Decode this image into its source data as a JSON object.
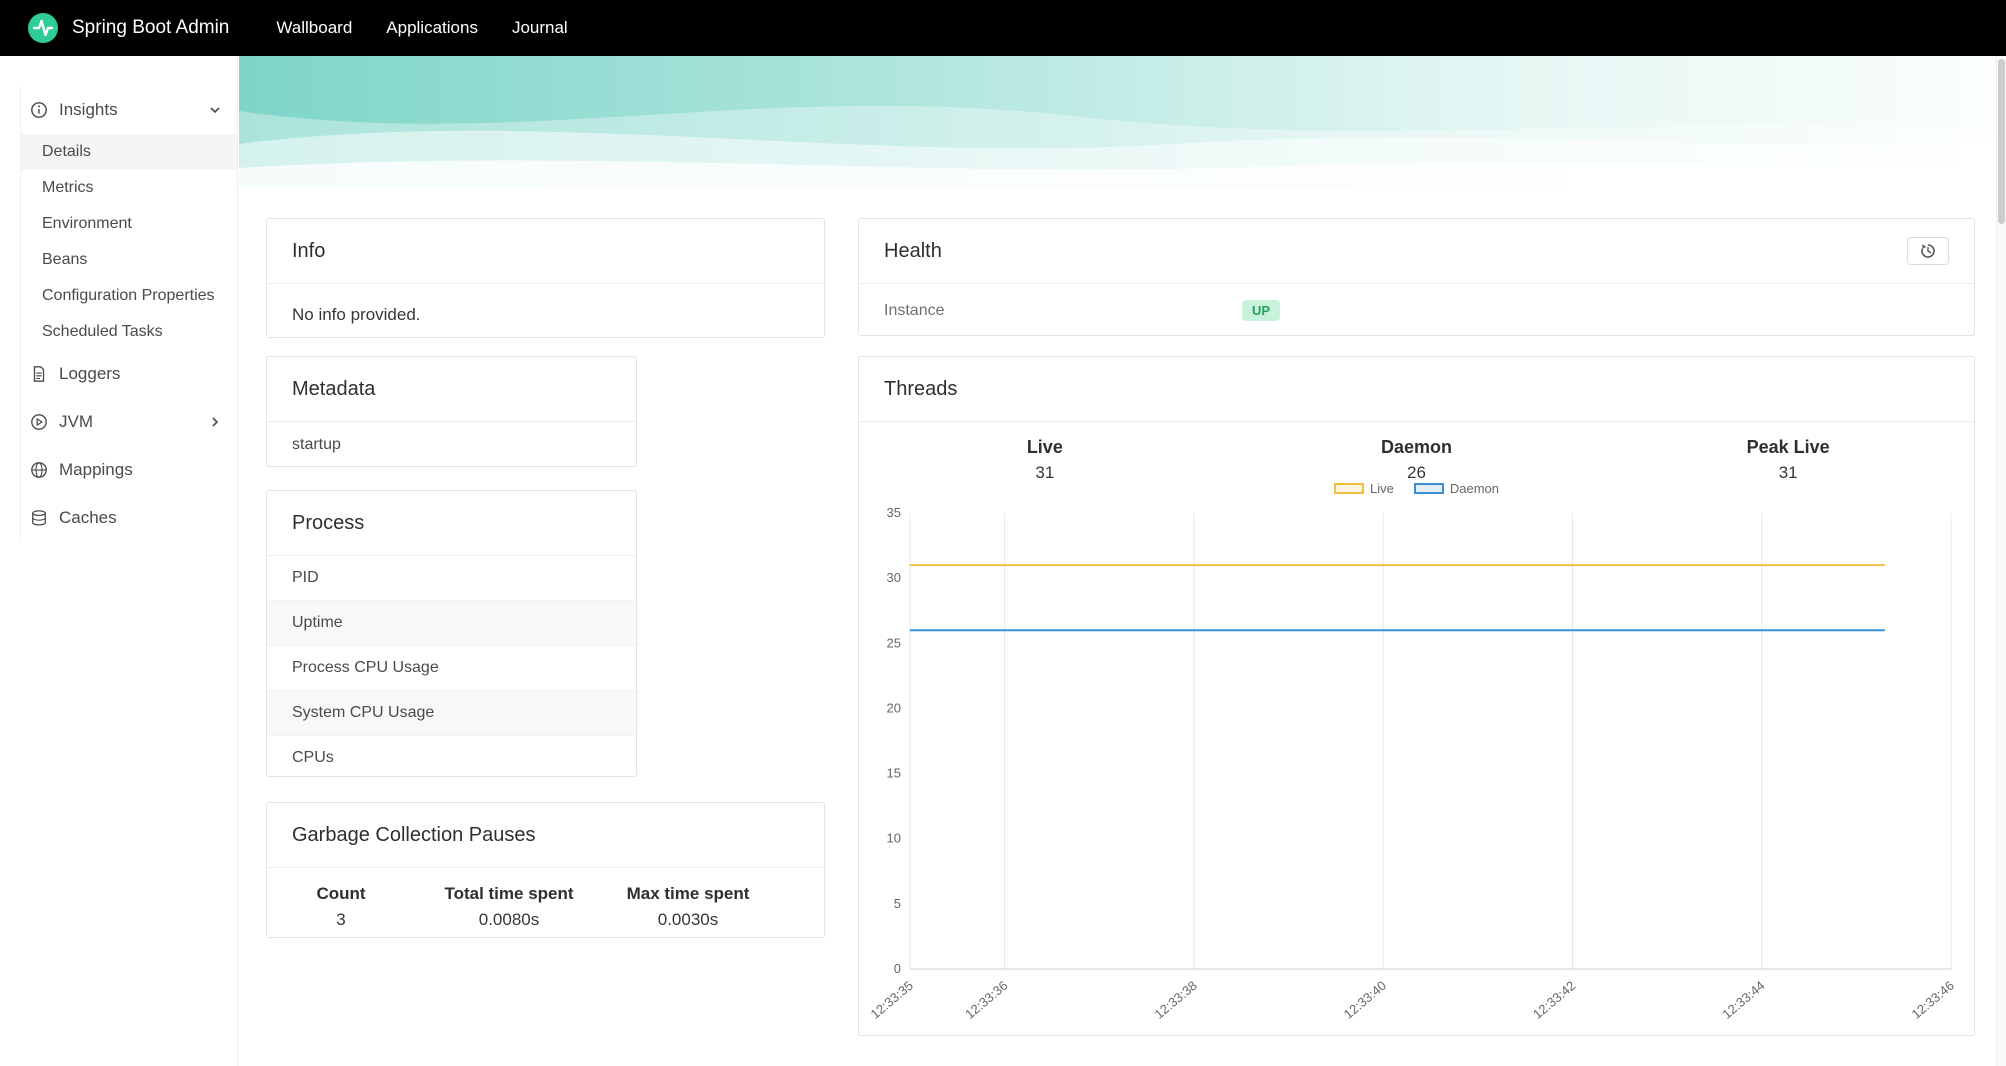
{
  "navbar": {
    "brand": "Spring Boot Admin",
    "items": [
      "Wallboard",
      "Applications",
      "Journal"
    ]
  },
  "sidebar": {
    "insights": {
      "label": "Insights",
      "children": [
        "Details",
        "Metrics",
        "Environment",
        "Beans",
        "Configuration Properties",
        "Scheduled Tasks"
      ],
      "active_child": "Details"
    },
    "items": [
      "Loggers",
      "JVM",
      "Mappings",
      "Caches"
    ]
  },
  "panels": {
    "info": {
      "title": "Info",
      "body": "No info provided."
    },
    "health": {
      "title": "Health",
      "instance_label": "Instance",
      "status": "UP"
    },
    "metadata": {
      "title": "Metadata",
      "rows": [
        "startup"
      ]
    },
    "process": {
      "title": "Process",
      "rows": [
        "PID",
        "Uptime",
        "Process CPU Usage",
        "System CPU Usage",
        "CPUs"
      ]
    },
    "gc": {
      "title": "Garbage Collection Pauses",
      "columns": [
        "Count",
        "Total time spent",
        "Max time spent"
      ],
      "values": [
        "3",
        "0.0080s",
        "0.0030s"
      ]
    },
    "threads": {
      "title": "Threads",
      "stats": [
        {
          "label": "Live",
          "value": "31"
        },
        {
          "label": "Daemon",
          "value": "26"
        },
        {
          "label": "Peak Live",
          "value": "31"
        }
      ]
    }
  },
  "colors": {
    "logo_green": "#2fcc9a",
    "navbar_bg": "#000000",
    "badge_up_bg": "#c8f2dc",
    "badge_up_text": "#27a05d",
    "hero_teal": "#7ed5c8"
  },
  "chart_data": {
    "type": "line",
    "title": "Threads",
    "xlabel": "",
    "ylabel": "",
    "ylim": [
      0,
      35
    ],
    "y_ticks": [
      0,
      5,
      10,
      15,
      20,
      25,
      30,
      35
    ],
    "x_range": [
      0,
      11
    ],
    "x_ticks": [
      {
        "t": 0,
        "label": "12:33:35"
      },
      {
        "t": 1,
        "label": "12:33:36"
      },
      {
        "t": 3,
        "label": "12:33:38"
      },
      {
        "t": 5,
        "label": "12:33:40"
      },
      {
        "t": 7,
        "label": "12:33:42"
      },
      {
        "t": 9,
        "label": "12:33:44"
      },
      {
        "t": 11,
        "label": "12:33:46"
      }
    ],
    "grid": "vertical",
    "legend_position": "top",
    "series": [
      {
        "name": "Live",
        "color": "#f0bf3f",
        "points": [
          [
            0,
            31
          ],
          [
            10.3,
            31
          ]
        ]
      },
      {
        "name": "Daemon",
        "color": "#3e8ed0",
        "points": [
          [
            0,
            26
          ],
          [
            10.3,
            26
          ]
        ]
      }
    ]
  }
}
